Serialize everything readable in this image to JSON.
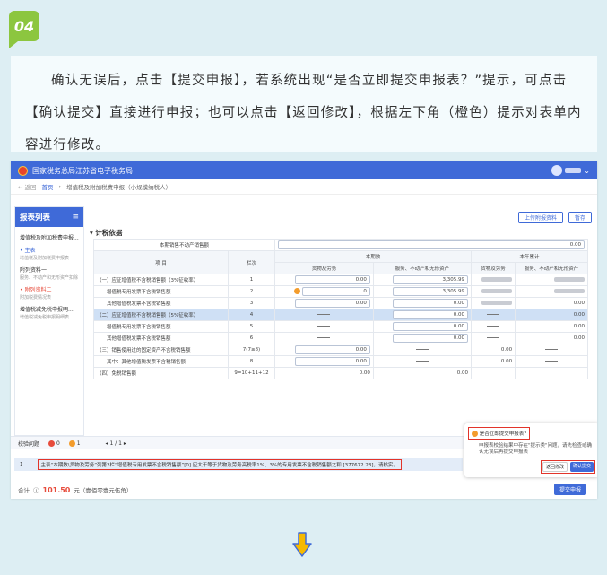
{
  "step": {
    "badge": "04"
  },
  "instruction": "确认无误后，点击【提交申报】，若系统出现“是否立即提交申报表？”提示，可点击【确认提交】直接进行申报；也可以点击【返回修改】，根据左下角（橙色）提示对表单内容进行修改。",
  "app": {
    "title": "国家税务总局江苏省电子税务局",
    "back": "返回",
    "breadcrumb_home": "首页",
    "breadcrumb_current": "增值税及附加税费申报（小规模纳税人）"
  },
  "sidebar": {
    "title": "报表列表",
    "items": [
      {
        "label": "增值税及附加税费申报...",
        "sub": ""
      },
      {
        "label": "• 主表",
        "sub": "增值税及附加税费申报表"
      },
      {
        "label": "附列资料一",
        "sub": "服务、不动产和无形资产扣除"
      },
      {
        "label": "• 附列资料二",
        "sub": "附加税费情况表"
      },
      {
        "label": "增值税减免税申报明...",
        "sub": "增值税减免税申报明细表"
      }
    ]
  },
  "toolbar": {
    "upload": "上传附报资料",
    "save": "暂存"
  },
  "section_title": "计税依据",
  "table": {
    "top_row_label": "本期销售不动产销售额",
    "top_row_value": "0.00",
    "header_item": "项 目",
    "header_line": "栏次",
    "header_current": "本期数",
    "header_ytd": "本年累计",
    "header_goods": "货物及劳务",
    "header_services": "服务、不动产和无形资产",
    "rows": [
      {
        "label": "（一）应征增值税不含税销售额（3%征收率）",
        "line": "1",
        "goods": "0.00",
        "svc": "3,305.99"
      },
      {
        "label": "增值税专用发票不含税销售额",
        "line": "2",
        "goods": "0",
        "svc": "3,305.99"
      },
      {
        "label": "其他增值税发票不含税销售额",
        "line": "3",
        "goods": "0.00",
        "svc": "0.00",
        "ytd_svc": "0.00"
      },
      {
        "label": "（二）应征增值税不含税销售额（5%征收率）",
        "line": "4",
        "svc": "0.00",
        "ytd_svc": "0.00"
      },
      {
        "label": "增值税专用发票不含税销售额",
        "line": "5",
        "svc": "0.00",
        "ytd_svc": "0.00"
      },
      {
        "label": "其他增值税发票不含税销售额",
        "line": "6",
        "svc": "0.00",
        "ytd_svc": "0.00"
      },
      {
        "label": "（三）销售使用过的固定资产不含税销售额",
        "line": "7(7≥8)",
        "goods": "0.00",
        "ytd_goods": "0.00"
      },
      {
        "label": "其中：其他增值税发票不含税销售额",
        "line": "8",
        "goods": "0.00",
        "ytd_goods": "0.00"
      },
      {
        "label": "（四）免税销售额",
        "line": "9=10+11+12",
        "goods": "0.00",
        "svc": "0.00"
      }
    ]
  },
  "validation": {
    "label": "校验问题",
    "error_count": "0",
    "warn_count": "1",
    "pager": "1 / 1",
    "row_index": "1",
    "message": "主表“本期数\\货物及劳务”列第2栏“增值税专用发票不含税销售额”[0] 应大于等于货物及劳务高税率1%、3%的专用发票不含税销售额之和 [377672.23]，请核实。"
  },
  "footer": {
    "total_label": "合计",
    "total_value": "101.50",
    "total_unit": "元（壹佰零壹元伍角）",
    "submit": "提交申报"
  },
  "dialog": {
    "title": "是否立即提交申报表?",
    "body": "申报表校验结果中存在\"提示类\"问题，请先检查或确认无误后再提交申报表",
    "back": "返回修改",
    "confirm": "确认提交"
  },
  "colors": {
    "accent": "#3f6ad8",
    "badge": "#8cc63f",
    "warn": "#f39c2c",
    "error": "#e74c3c"
  }
}
